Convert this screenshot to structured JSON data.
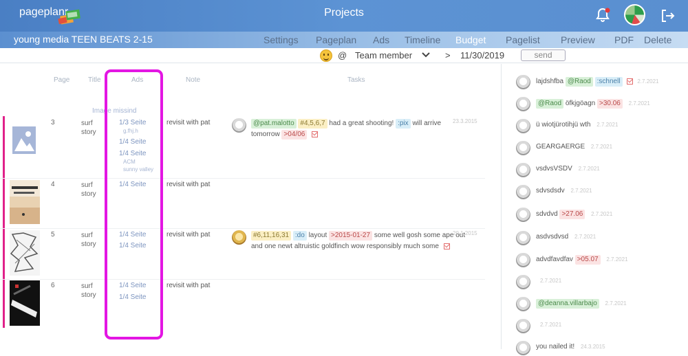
{
  "header": {
    "logo": "pageplanr",
    "title": "Projects"
  },
  "subbar": {
    "project_name": "young media TEEN BEATS 2-15",
    "nav": [
      "Settings",
      "Pageplan",
      "Ads",
      "Timeline",
      "Budget",
      "Pagelist",
      "Preview",
      "PDF",
      "Delete"
    ]
  },
  "filter": {
    "at": "@",
    "member": "Team member",
    "gt": ">",
    "date": "11/30/2019",
    "send": "send"
  },
  "table": {
    "columns": [
      "Page",
      "Title",
      "Ads",
      "Note",
      "Tasks"
    ],
    "image_missing": "Image missind",
    "rows": [
      {
        "page": "3",
        "title": "surf story",
        "ads": [
          "1/3 Seite",
          "1/4 Seite",
          "1/4 Seite"
        ],
        "ad_subs": [
          "g.fhj.h",
          "ACM",
          "sunny valley"
        ],
        "note": "revisit with pat",
        "task": {
          "tags": [
            "@pat.malotto",
            "#4,5,6,7"
          ],
          "text": "had a great shooting!",
          "tag3": ":pix",
          "text2": "will arrive tomorrow",
          "due": ">04/06",
          "date": "23.3.2015"
        }
      },
      {
        "page": "4",
        "title": "surf story",
        "ads": [
          "1/4 Seite"
        ],
        "note": "revisit with pat"
      },
      {
        "page": "5",
        "title": "surf story",
        "ads": [
          "1/4 Seite",
          "1/4 Seite"
        ],
        "note": "revisit with pat",
        "task": {
          "tag1": "#6,11,16,31",
          "tag2": ":do",
          "w1": "layout",
          "tag3": ">2015-01-27",
          "text": "some well gosh some ape out and one newt altruistic goldfinch wow responsibly much some",
          "date": "20.1.2015"
        }
      },
      {
        "page": "6",
        "title": "surf story",
        "ads": [
          "1/4 Seite",
          "1/4 Seite"
        ],
        "note": "revisit with pat"
      }
    ]
  },
  "comments": [
    {
      "parts": [
        {
          "t": "lajdshfba",
          "c": ""
        },
        {
          "t": "@Raod",
          "c": "tg"
        },
        {
          "t": ":schnell",
          "c": "tb"
        }
      ],
      "check": true,
      "date": "2.7.2021"
    },
    {
      "parts": [
        {
          "t": "@Raod",
          "c": "tg"
        },
        {
          "t": "öfkjgöagn",
          "c": ""
        },
        {
          "t": ">30.06",
          "c": "tr"
        }
      ],
      "date": "2.7.2021"
    },
    {
      "parts": [
        {
          "t": "ü wiotjürotihjü wth",
          "c": ""
        }
      ],
      "date": "2.7.2021"
    },
    {
      "parts": [
        {
          "t": "GEARGAERGE",
          "c": ""
        }
      ],
      "date": "2.7.2021"
    },
    {
      "parts": [
        {
          "t": "vsdvsVSDV",
          "c": ""
        }
      ],
      "date": "2.7.2021"
    },
    {
      "parts": [
        {
          "t": "sdvsdsdv",
          "c": ""
        }
      ],
      "date": "2.7.2021"
    },
    {
      "parts": [
        {
          "t": "sdvdvd",
          "c": ""
        },
        {
          "t": ">27.06",
          "c": "tr"
        }
      ],
      "date": "2.7.2021"
    },
    {
      "parts": [
        {
          "t": "asdvsdvsd",
          "c": ""
        }
      ],
      "date": "2.7.2021"
    },
    {
      "parts": [
        {
          "t": "advdfavdfav",
          "c": ""
        },
        {
          "t": ">05.07",
          "c": "tr"
        }
      ],
      "date": "2.7.2021"
    },
    {
      "parts": [],
      "date": "2.7.2021"
    },
    {
      "parts": [
        {
          "t": "@deanna.villarbajo",
          "c": "tg"
        }
      ],
      "date": "2.7.2021"
    },
    {
      "parts": [],
      "date": "2.7.2021"
    },
    {
      "parts": [
        {
          "t": "you nailed it!",
          "c": ""
        }
      ],
      "date": "24.3.2015"
    }
  ],
  "colors": {
    "accent": "#4a7fc4",
    "highlight": "#e316e3",
    "page_bar": "#e0218a"
  }
}
